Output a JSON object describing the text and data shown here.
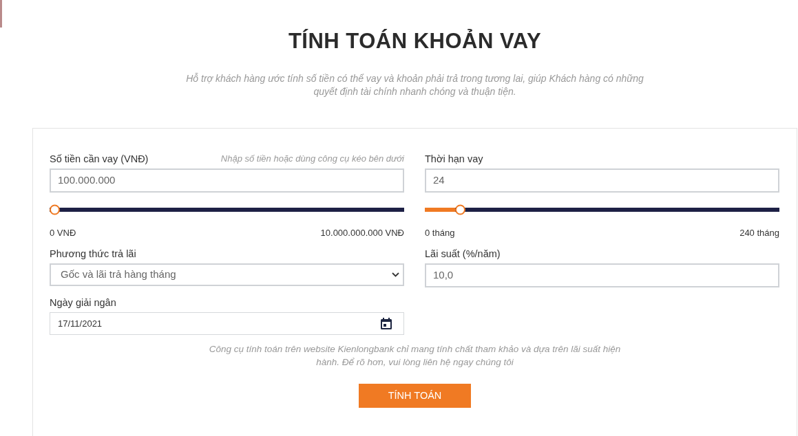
{
  "title": "TÍNH TOÁN KHOẢN VAY",
  "subtitle": "Hỗ trợ khách hàng ước tính số tiền có thể vay và khoản phải trả trong tương lai, giúp Khách hàng có những quyết định tài chính nhanh chóng và thuận tiện.",
  "fields": [
    {
      "kind": "text",
      "label": "Số tiền cần vay (VNĐ)",
      "hint": "Nhập số tiền hoặc dùng công cụ kéo bên dưới",
      "value": "100.000.000",
      "slider": {
        "level": 0.01,
        "min_label": "0 VNĐ",
        "max_label": "10.000.000.000 VNĐ"
      }
    },
    {
      "kind": "text",
      "label": "Thời hạn vay",
      "value": "24",
      "slider": {
        "level": 0.1,
        "min_label": "0 tháng",
        "max_label": "240 tháng"
      }
    },
    {
      "kind": "select",
      "label": "Phương thức trả lãi",
      "value": "Gốc và lãi trả hàng tháng"
    },
    {
      "kind": "text",
      "label": "Lãi suất (%/năm)",
      "value": "10,0"
    },
    {
      "kind": "date",
      "label": "Ngày giải ngân",
      "value": "17/11/2021"
    }
  ],
  "note": "Công cụ tính toán trên website Kienlongbank chỉ mang tính chất tham khảo và dựa trên lãi suất hiện hành. Để rõ hơn, vui lòng liên hệ ngay chúng tôi",
  "submit_button": "TÍNH TOÁN"
}
